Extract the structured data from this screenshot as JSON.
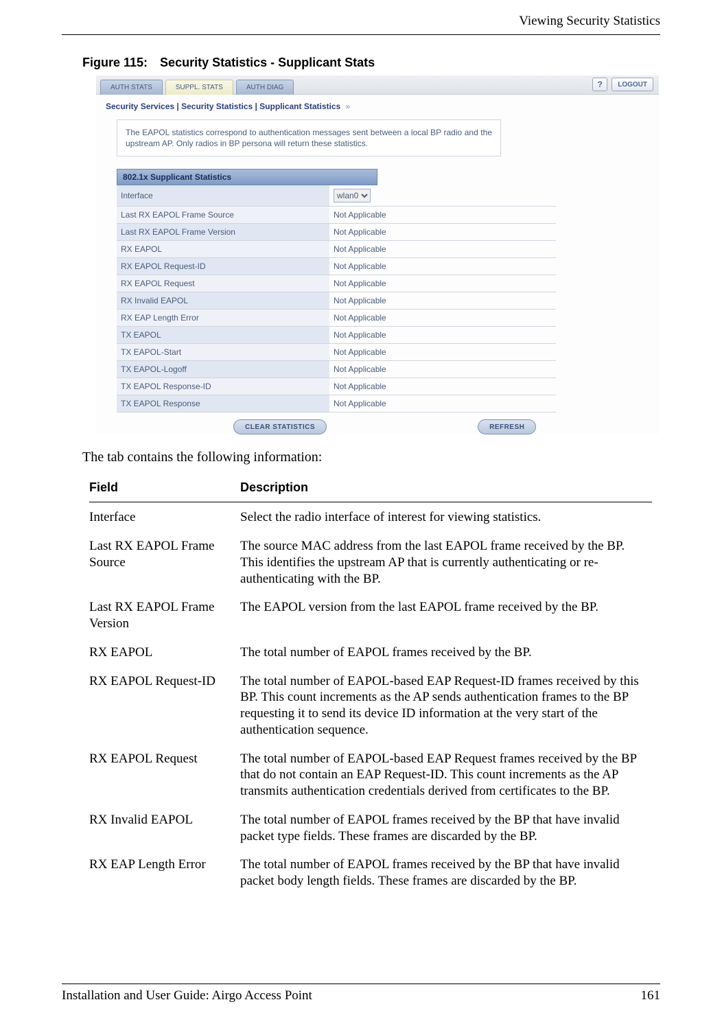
{
  "header": {
    "section_title": "Viewing Security Statistics"
  },
  "figure": {
    "number": "Figure 115:",
    "title": "Security Statistics - Supplicant Stats"
  },
  "screenshot": {
    "tabs": [
      {
        "label": "AUTH STATS",
        "active": false
      },
      {
        "label": "SUPPL. STATS",
        "active": true
      },
      {
        "label": "AUTH DIAG",
        "active": false
      }
    ],
    "help_label": "?",
    "logout_label": "LOGOUT",
    "breadcrumb": "Security Services | Security Statistics | Supplicant Statistics",
    "breadcrumb_arrow": "»",
    "infobox": "The EAPOL statistics correspond to authentication messages sent between a local BP radio and the upstream AP. Only radios in BP persona will return these statistics.",
    "section_title": "802.1x Supplicant Statistics",
    "interface_select": {
      "value": "wlan0"
    },
    "rows": [
      {
        "label": "Interface",
        "value_is_select": true
      },
      {
        "label": "Last RX EAPOL Frame Source",
        "value": "Not Applicable"
      },
      {
        "label": "Last RX EAPOL Frame Version",
        "value": "Not Applicable"
      },
      {
        "label": "RX EAPOL",
        "value": "Not Applicable"
      },
      {
        "label": "RX EAPOL Request-ID",
        "value": "Not Applicable"
      },
      {
        "label": "RX EAPOL Request",
        "value": "Not Applicable"
      },
      {
        "label": "RX Invalid EAPOL",
        "value": "Not Applicable"
      },
      {
        "label": "RX EAP Length Error",
        "value": "Not Applicable"
      },
      {
        "label": "TX EAPOL",
        "value": "Not Applicable"
      },
      {
        "label": "TX EAPOL-Start",
        "value": "Not Applicable"
      },
      {
        "label": "TX EAPOL-Logoff",
        "value": "Not Applicable"
      },
      {
        "label": "TX EAPOL Response-ID",
        "value": "Not Applicable"
      },
      {
        "label": "TX EAPOL Response",
        "value": "Not Applicable"
      }
    ],
    "buttons": {
      "clear": "CLEAR STATISTICS",
      "refresh": "REFRESH"
    }
  },
  "body_intro": "The tab contains the following information:",
  "desc_table": {
    "header_field": "Field",
    "header_desc": "Description",
    "rows": [
      {
        "field": "Interface",
        "desc": "Select the radio interface of interest for viewing statistics."
      },
      {
        "field": "Last RX EAPOL Frame Source",
        "desc": "The source MAC address from the last EAPOL frame received by the BP. This identifies the upstream AP that is currently authenticating or re-authenticating with the BP."
      },
      {
        "field": "Last RX EAPOL Frame Version",
        "desc": "The EAPOL version from the last EAPOL frame received by the BP."
      },
      {
        "field": "RX EAPOL",
        "desc": "The total number of EAPOL frames received by the BP."
      },
      {
        "field": "RX EAPOL Request-ID",
        "desc": "The total number of EAPOL-based EAP Request-ID frames received by this BP. This count increments as the AP sends authentication frames to the BP requesting it to send its device ID information at the very start of the authentication sequence."
      },
      {
        "field": "RX EAPOL Request",
        "desc": "The total number of EAPOL-based EAP Request frames received by the BP that do not contain an EAP Request-ID. This count increments as the AP transmits authentication credentials derived from certificates to the BP."
      },
      {
        "field": "RX Invalid EAPOL",
        "desc": "The total number of EAPOL frames received by the BP that have invalid packet type fields. These frames are discarded by the BP."
      },
      {
        "field": "RX EAP Length Error",
        "desc": "The total number of EAPOL frames received by the BP that have invalid packet body length fields. These frames are discarded by the BP."
      }
    ]
  },
  "footer": {
    "left": "Installation and User Guide: Airgo Access Point",
    "right": "161"
  }
}
